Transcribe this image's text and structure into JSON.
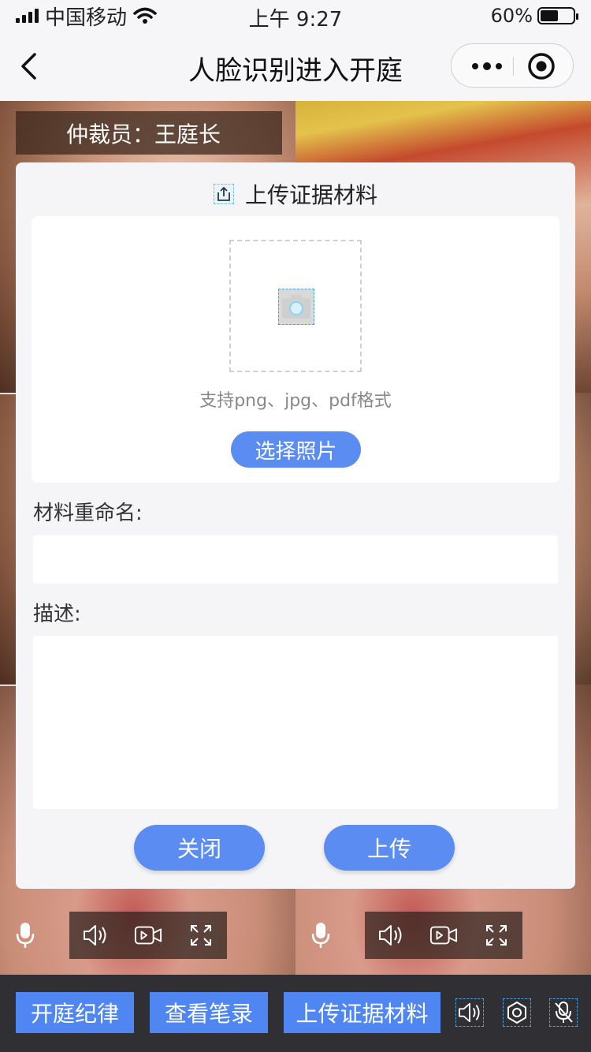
{
  "status_bar": {
    "carrier": "中国移动",
    "time": "上午 9:27",
    "battery_percent": "60%",
    "battery_level": 0.6
  },
  "nav": {
    "title": "人脸识别进入开庭",
    "icons": [
      "back-icon",
      "more-icon",
      "target-icon"
    ]
  },
  "video": {
    "arbitrator_label": "仲裁员：王庭长"
  },
  "modal": {
    "title": "上传证据材料",
    "formats_hint": "支持png、jpg、pdf格式",
    "choose_photo": "选择照片",
    "rename_label": "材料重命名:",
    "rename_value": "",
    "description_label": "描述:",
    "description_value": "",
    "close_button": "关闭",
    "upload_button": "上传"
  },
  "toolbar": {
    "rules_button": "开庭纪律",
    "notes_button": "查看笔录",
    "upload_evidence_button": "上传证据材料",
    "icons": [
      "speaker-icon",
      "settings-icon",
      "mic-off-icon"
    ]
  },
  "colors": {
    "accent": "#5b8cf2",
    "toolbar_bg": "#2f2f34"
  }
}
